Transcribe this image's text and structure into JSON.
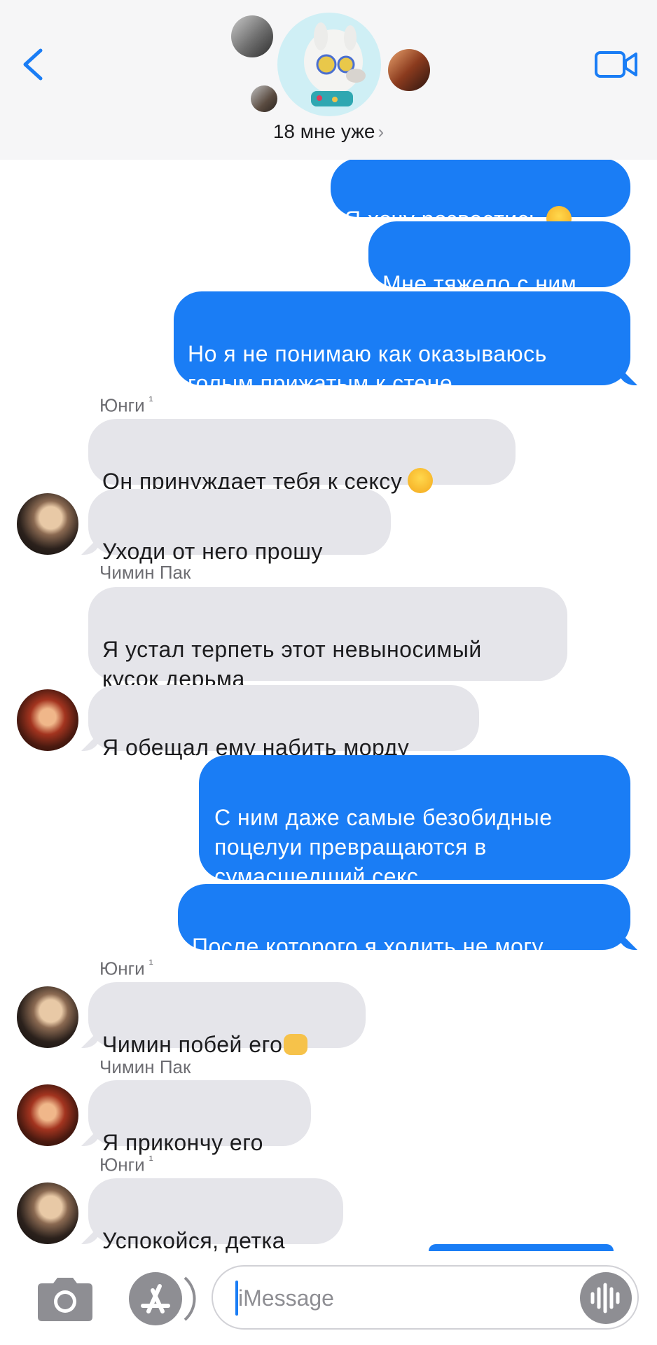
{
  "header": {
    "group_name": "18 мне уже",
    "chevron": "›",
    "back_icon": "chevron-left-icon",
    "video_icon": "video-camera-icon"
  },
  "messages": [
    {
      "type": "out",
      "text": "Я хочу развестись",
      "emoji": "sad-face"
    },
    {
      "type": "out",
      "text": "Мне тяжело с ним"
    },
    {
      "type": "out",
      "text": "Но я не понимаю как оказываюсь\nголым прижатым  к стене"
    },
    {
      "type": "sender",
      "name": "Юнги",
      "mark": "¹"
    },
    {
      "type": "in",
      "text": "Он принуждает тебя к сексу",
      "emoji": "surprised-face"
    },
    {
      "type": "in",
      "text": "Уходи от него прошу"
    },
    {
      "type": "sender",
      "name": "Чимин Пак"
    },
    {
      "type": "in",
      "text": "Я устал терпеть этот невыносимый\nкусок дерьма"
    },
    {
      "type": "in",
      "text": "Я обещал ему набить морду"
    },
    {
      "type": "out",
      "text": "С ним даже самые безобидные\nпоцелуи превращаются  в\nсумасшедший секс"
    },
    {
      "type": "out",
      "text": "После которого я ходить не могу"
    },
    {
      "type": "sender",
      "name": "Юнги",
      "mark": "¹"
    },
    {
      "type": "in",
      "text": "Чимин побей его",
      "emoji": "fist"
    },
    {
      "type": "sender",
      "name": "Чимин Пак"
    },
    {
      "type": "in",
      "text": "Я прикончу его"
    },
    {
      "type": "sender",
      "name": "Юнги",
      "mark": "¹"
    },
    {
      "type": "in",
      "text": "Успокойся,  детка"
    }
  ],
  "input": {
    "placeholder": "iMessage",
    "camera_icon": "camera-icon",
    "appstore_icon": "app-store-icon",
    "audio_icon": "audio-waveform-icon"
  },
  "colors": {
    "outgoing": "#1a7df5",
    "incoming": "#e5e5ea",
    "accent": "#1a7df5"
  }
}
